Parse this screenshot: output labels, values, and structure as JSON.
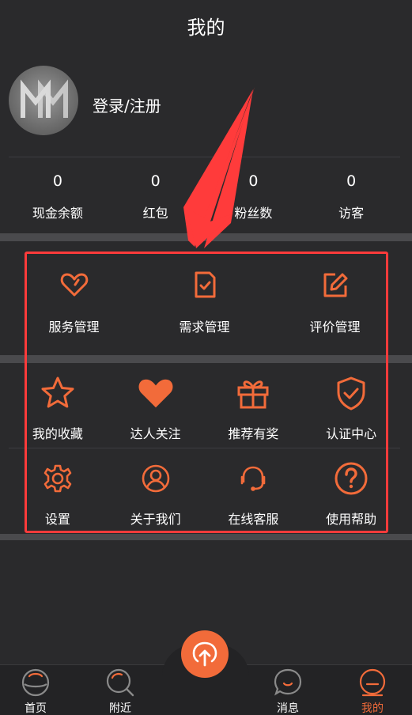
{
  "header": {
    "title": "我的"
  },
  "profile": {
    "login_label": "登录/注册"
  },
  "stats": [
    {
      "value": "0",
      "label": "现金余额"
    },
    {
      "value": "0",
      "label": "红包"
    },
    {
      "value": "0",
      "label": "粉丝数"
    },
    {
      "value": "0",
      "label": "访客"
    }
  ],
  "management": [
    {
      "label": "服务管理",
      "icon": "heart-outline-icon"
    },
    {
      "label": "需求管理",
      "icon": "checked-document-icon"
    },
    {
      "label": "评价管理",
      "icon": "edit-pen-icon"
    }
  ],
  "features_row1": [
    {
      "label": "我的收藏",
      "icon": "star-icon"
    },
    {
      "label": "达人关注",
      "icon": "heart-filled-icon"
    },
    {
      "label": "推荐有奖",
      "icon": "gift-icon"
    },
    {
      "label": "认证中心",
      "icon": "shield-check-icon"
    }
  ],
  "features_row2": [
    {
      "label": "设置",
      "icon": "gear-icon"
    },
    {
      "label": "关于我们",
      "icon": "user-circle-icon"
    },
    {
      "label": "在线客服",
      "icon": "headset-icon"
    },
    {
      "label": "使用帮助",
      "icon": "help-question-icon"
    }
  ],
  "tabbar": {
    "items": [
      {
        "label": "首页",
        "icon": "home-icon"
      },
      {
        "label": "附近",
        "icon": "search-nearby-icon"
      },
      {
        "label": "消息",
        "icon": "message-icon"
      },
      {
        "label": "我的",
        "icon": "profile-icon"
      }
    ],
    "active_index": 3,
    "center_icon": "publish-up-arrow-icon"
  },
  "colors": {
    "background": "#2a2a2c",
    "accent": "#f26b3a",
    "highlight_annotation": "#ff3b3b",
    "separator": "#4a4a4d"
  }
}
